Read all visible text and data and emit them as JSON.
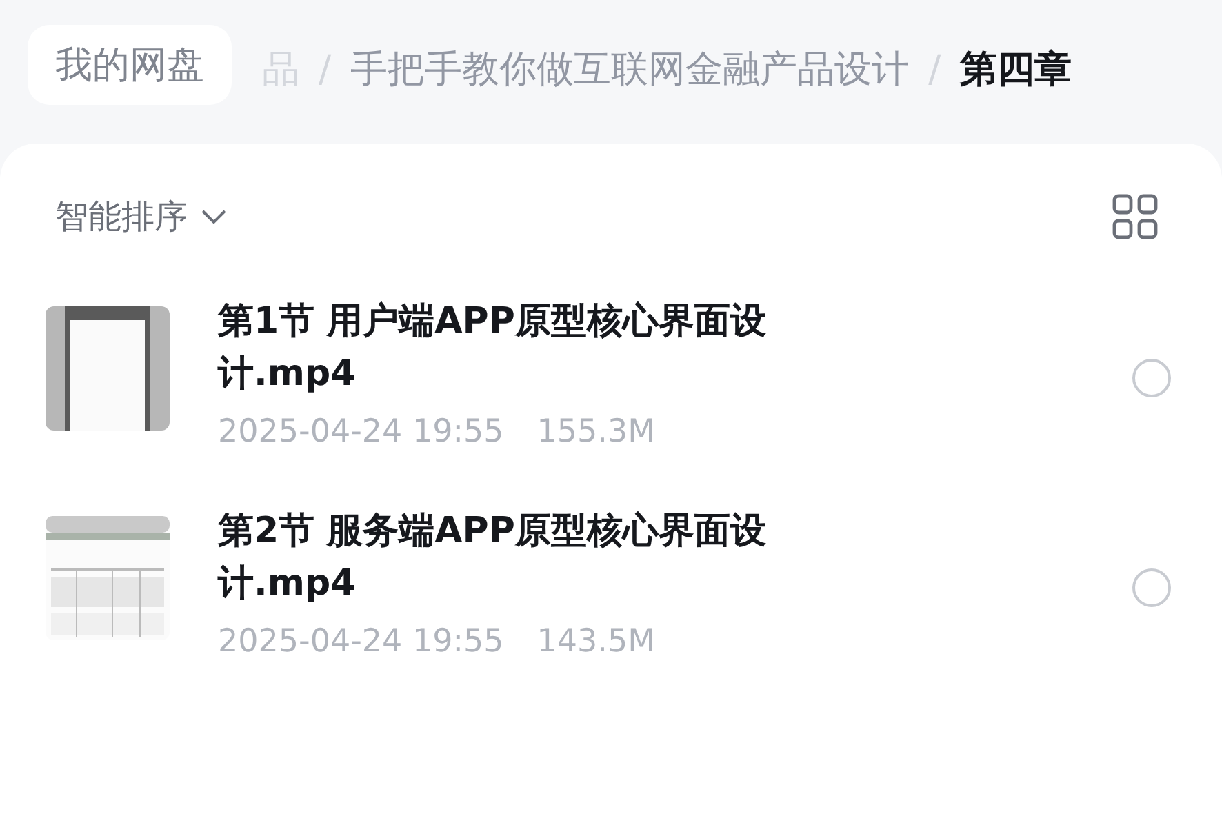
{
  "breadcrumb": {
    "home": "我的网盘",
    "separator": "/",
    "items": [
      {
        "label": "品",
        "kind": "faded"
      },
      {
        "label": "手把手教你做互联网金融产品设计",
        "kind": "normal"
      },
      {
        "label": "第四章",
        "kind": "current"
      }
    ]
  },
  "toolbar": {
    "sort": "智能排序"
  },
  "files": [
    {
      "title": "第1节 用户端APP原型核心界面设计.mp4",
      "date": "2025-04-24 19:55",
      "size": "155.3M",
      "selected": false
    },
    {
      "title": "第2节 服务端APP原型核心界面设计.mp4",
      "date": "2025-04-24 19:55",
      "size": "143.5M",
      "selected": false
    }
  ]
}
